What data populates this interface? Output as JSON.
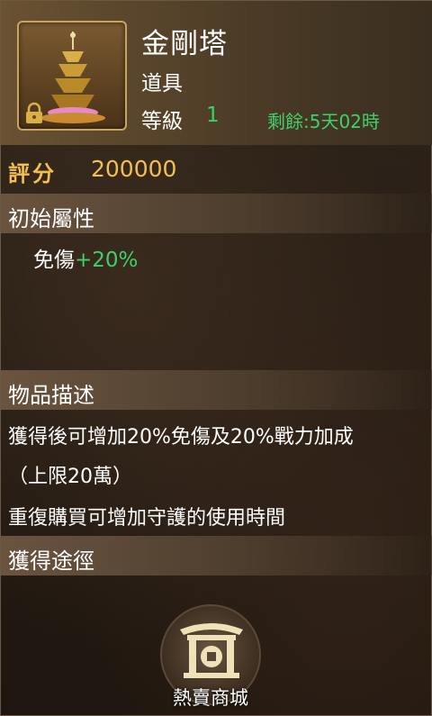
{
  "item": {
    "name": "金剛塔",
    "type": "道具",
    "level_label": "等級",
    "level_value": "1",
    "remaining": "剩餘:5天02時"
  },
  "score": {
    "label": "評分",
    "value": "200000"
  },
  "sections": {
    "initial_attributes": "初始屬性",
    "description": "物品描述",
    "acquire": "獲得途徑"
  },
  "attributes": [
    {
      "name": "免傷",
      "value": "+20%"
    }
  ],
  "description_lines": [
    "獲得後可增加20%免傷及20%戰力加成",
    "（上限20萬）",
    "重復購買可增加守護的使用時間"
  ],
  "acquire_button": {
    "label": "熱賣商城",
    "icon": "shop-gate-icon"
  },
  "icons": {
    "item": "pagoda-icon",
    "lock": "lock-icon"
  },
  "colors": {
    "gold": "#f3c050",
    "green": "#3fd06a"
  }
}
